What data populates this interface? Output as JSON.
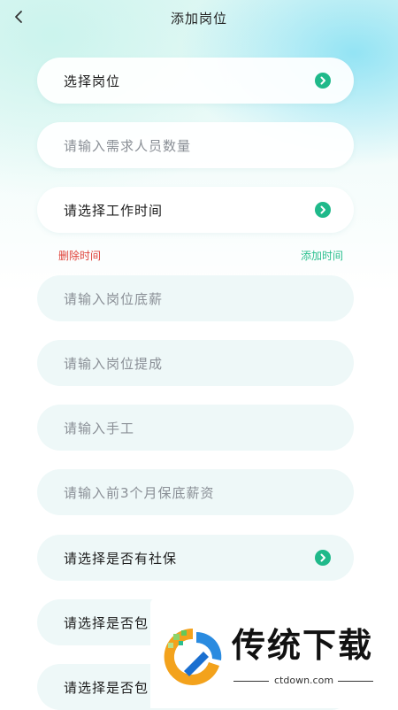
{
  "header": {
    "title": "添加岗位",
    "back_icon": "chevron-left-icon"
  },
  "fields": {
    "position": {
      "label": "选择岗位",
      "icon": "chevron-right-circle-icon"
    },
    "headcount": {
      "placeholder": "请输入需求人员数量"
    },
    "work_time": {
      "label": "请选择工作时间",
      "icon": "chevron-right-circle-icon"
    },
    "base_salary": {
      "placeholder": "请输入岗位底薪"
    },
    "commission": {
      "placeholder": "请输入岗位提成"
    },
    "manual_work": {
      "placeholder": "请输入手工"
    },
    "guarantee_salary": {
      "placeholder": "请输入前3个月保底薪资"
    },
    "social_insurance": {
      "label": "请选择是否有社保",
      "icon": "chevron-right-circle-icon"
    },
    "select_row_a": {
      "label": "请选择是否包"
    },
    "select_row_b": {
      "label": "请选择是否包"
    }
  },
  "time_actions": {
    "delete_label": "删除时间",
    "add_label": "添加时间"
  },
  "colors": {
    "accent_green": "#2bbf8e",
    "delete_red": "#e0443c",
    "icon_green": "#1fb98a"
  },
  "watermark": {
    "title": "传统下载",
    "url": "ctdown.com"
  }
}
